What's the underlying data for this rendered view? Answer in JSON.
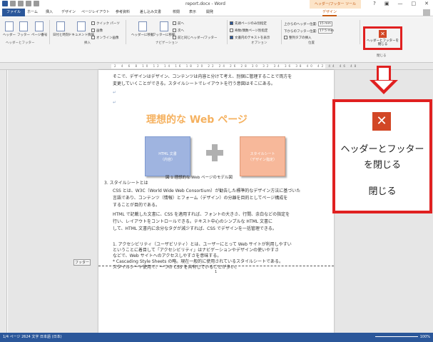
{
  "window": {
    "title": "report.docx - Word",
    "context_tab_group": "ヘッダー/フッター ツール",
    "controls": [
      "?",
      "▣",
      "—",
      "□",
      "✕"
    ]
  },
  "tabs": [
    "ファイル",
    "ホーム",
    "挿入",
    "デザイン",
    "ページレイアウト",
    "参考資料",
    "差し込み文書",
    "校閲",
    "表示",
    "開発",
    "デザイン"
  ],
  "ribbon": {
    "groups": [
      "ヘッダーとフッター",
      "挿入",
      "ナビゲーション",
      "オプション",
      "位置",
      "閉じる"
    ],
    "buttons": {
      "header": "ヘッダー",
      "footer": "フッター",
      "page_number": "ページ番号",
      "date_time": "日付と時刻",
      "doc_info": "ドキュメント情報",
      "quick_parts": "クイック パーツ",
      "picture": "画像",
      "online_picture": "オンライン画像",
      "goto_header": "ヘッダーに移動",
      "goto_footer": "フッターに移動",
      "prev": "前へ",
      "next": "次へ",
      "link_prev": "前と同じヘッダー/フッター",
      "first_page": "先頭ページのみ別指定",
      "odd_even": "奇数/偶数ページ別指定",
      "show_text": "文書内のテキストを表示",
      "header_pos_label": "上からのヘッダー位置:",
      "header_pos_value": "15 mm",
      "footer_pos_label": "下からのフッター位置:",
      "footer_pos_value": "17.5 mm",
      "align_tab": "整列タブの挿入",
      "close_label": "ヘッダーとフッターを閉じる",
      "close_group": "閉じる"
    }
  },
  "ruler": {
    "numbers": "2 4 6 8 10 12 14 16 18 20 22 24 26 28 30 32 34 36 38 40 42 44 46 48"
  },
  "document": {
    "lines_top": [
      "そこで、デザインはデザイン、コンテンツは内容と分けて考え、別個に管理することで両方を",
      "変更していくことができる。スタイルシートでレイアウトを行う意図はそこにある。"
    ],
    "heading": "理想的な Web ページ",
    "box1": "HTML 文書\n（内容）",
    "box2": "スタイルシート\n（デザイン指定）",
    "caption": "図 1 理想的な Web ページのモデル図",
    "section": "3. スタイルシートとは",
    "body": [
      "CSS とは、W3C（World Wide Web Consortium）が勧告した標準的なデザイン方法に基づいた",
      "言語であり、コンテンツ（情報）とフォーム（デザイン）の分離を目的としてページ構成を",
      "することが目的である。",
      "HTML で記載した文書に、CSS を適用すれば、フォントの大きさ、行間、余白などの指定を",
      "行い、レイアウトをコントロールできる。テキスト中心のシンプルな HTML 文書に",
      "して、HTML 文書内に余分なタグが減少すれば、CSS でデザインを一括管理できる。",
      "1. アクセシビリティ（ユーザビリティ）とは、ユーザーにとって Web サイトが利用しやすい",
      "ということに着目して「アクセシビリティ」はナビゲーションやデザインの使いやすさ",
      "などで、Web サイトへのアクセスしやすさを意味する。",
      "* Cascading Style Sheets の略。現在一般的に使用されているスタイルシートである。",
      "スタイルシート使用で、一つの CSS を共有していることが多い。"
    ],
    "footer_tag": "フッター",
    "page_number": "1"
  },
  "status": {
    "left": "1/4 ページ   2624 文字   日本語 (日本)",
    "right": "100%"
  },
  "zoom_callout": {
    "icon": "close-icon",
    "label_line1": "ヘッダーとフッター",
    "label_line2": "を閉じる",
    "group": "閉じる"
  },
  "colors": {
    "accent": "#2b579a",
    "context": "#c55a11",
    "highlight": "#e02020",
    "close_icon": "#d24726"
  }
}
